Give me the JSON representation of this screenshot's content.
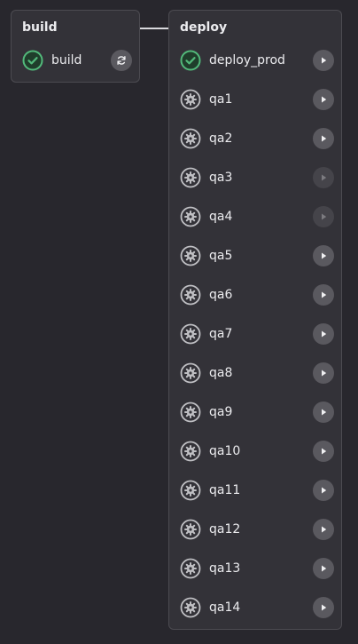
{
  "stages": {
    "build": {
      "title": "build",
      "jobs": [
        {
          "name": "build",
          "status": "success",
          "action": "retry",
          "action_enabled": true
        }
      ]
    },
    "deploy": {
      "title": "deploy",
      "jobs": [
        {
          "name": "deploy_prod",
          "status": "success",
          "action": "play",
          "action_enabled": true
        },
        {
          "name": "qa1",
          "status": "manual",
          "action": "play",
          "action_enabled": true
        },
        {
          "name": "qa2",
          "status": "manual",
          "action": "play",
          "action_enabled": true
        },
        {
          "name": "qa3",
          "status": "manual",
          "action": "play",
          "action_enabled": false
        },
        {
          "name": "qa4",
          "status": "manual",
          "action": "play",
          "action_enabled": false
        },
        {
          "name": "qa5",
          "status": "manual",
          "action": "play",
          "action_enabled": true
        },
        {
          "name": "qa6",
          "status": "manual",
          "action": "play",
          "action_enabled": true
        },
        {
          "name": "qa7",
          "status": "manual",
          "action": "play",
          "action_enabled": true
        },
        {
          "name": "qa8",
          "status": "manual",
          "action": "play",
          "action_enabled": true
        },
        {
          "name": "qa9",
          "status": "manual",
          "action": "play",
          "action_enabled": true
        },
        {
          "name": "qa10",
          "status": "manual",
          "action": "play",
          "action_enabled": true
        },
        {
          "name": "qa11",
          "status": "manual",
          "action": "play",
          "action_enabled": true
        },
        {
          "name": "qa12",
          "status": "manual",
          "action": "play",
          "action_enabled": true
        },
        {
          "name": "qa13",
          "status": "manual",
          "action": "play",
          "action_enabled": true
        },
        {
          "name": "qa14",
          "status": "manual",
          "action": "play",
          "action_enabled": true
        }
      ]
    }
  },
  "colors": {
    "background": "#28272d",
    "stage_bg": "#333238",
    "success": "#52b87a",
    "manual": "#bfbfc3",
    "action_bg": "#5a595f",
    "action_disabled_bg": "#45444a"
  },
  "icons": {
    "success": "check-circle-icon",
    "manual": "gear-circle-icon",
    "retry": "retry-icon",
    "play": "play-icon"
  }
}
